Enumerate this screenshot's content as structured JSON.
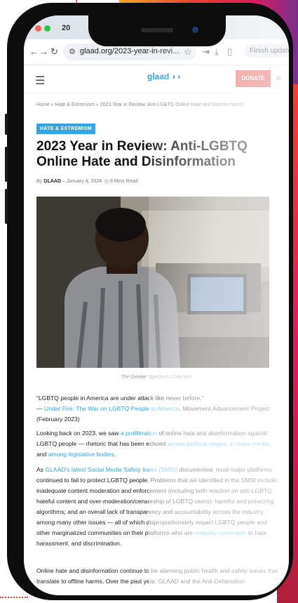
{
  "browser": {
    "tab_title": "20",
    "url": "glaad.org/2023-year-in-revi...",
    "finish_update": "Finish update"
  },
  "site": {
    "logo": "glaad",
    "donate": "DONATE"
  },
  "breadcrumb": {
    "home": "Home",
    "sep": "»",
    "category": "Hate & Extremism",
    "current": "2023 Year in Review: Anti-LGBTQ Online Hate and Disinformation"
  },
  "article": {
    "category_badge": "HATE & EXTREMISM",
    "title": "2023 Year in Review: Anti-LGBTQ Online Hate and Disinformation",
    "byline_prefix": "By",
    "author": "GLAAD",
    "date": "– January 4, 2024",
    "read_time": "8 Mins Read",
    "photo_caption": "The Gender Spectrum Collection",
    "quote": "“LGBTQ people in America are under attack like never before.”",
    "quote_dash": "— ",
    "quote_link": "Under Fire: The War on LGBTQ People in America",
    "quote_source": ", Movement Advancement Project (February 2023)",
    "p1_a": "Looking back on 2023, we saw ",
    "p1_link1": "a proliferation",
    "p1_b": " of online hate and disinformation against LGBTQ people — rhetoric that has been echoed ",
    "p1_link2": "across political stages",
    "p1_c": ", ",
    "p1_link3": "in mass media",
    "p1_d": ", and ",
    "p1_link4": "among legislative bodies",
    "p1_e": ".",
    "p2_a": "As ",
    "p2_link1": "GLAAD's latest Social Media Safety Index (SMSI)",
    "p2_b": " documented, most major platforms continued to fail to protect LGBTQ people. Problems that we identified in the SMSI include: inadequate content moderation and enforcement (including both inaction on anti-LGBTQ hateful content and over-moderation/censorship of LGBTQ users); harmful and polarizing algorithms; and an overall lack of transparency and accountability across the industry, among many other issues — all of which disproportionately impact LGBTQ people and other marginalized communities on their platforms who are ",
    "p2_link2": "uniquely vulnerable",
    "p2_c": " to hate, harassment, and discrimination.",
    "p3": "Online hate and disinformation continue to be alarming public health and safety issues that translate to offline harms. Over the past year, GLAAD and the Anti-Defamation"
  },
  "colors": {
    "accent": "#2fa7e3",
    "donate": "#e25651"
  }
}
